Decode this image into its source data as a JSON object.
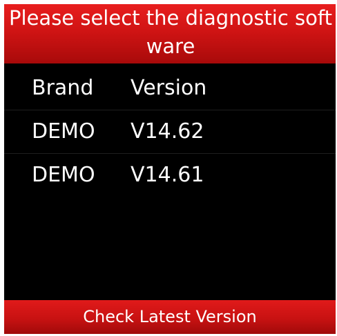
{
  "header": {
    "title": "Please select the diagnostic software"
  },
  "table": {
    "columns": [
      "Brand",
      "Version"
    ],
    "rows": [
      {
        "brand": "DEMO",
        "version": "V14.62"
      },
      {
        "brand": "DEMO",
        "version": "V14.61"
      }
    ]
  },
  "footer": {
    "button_label": "Check Latest Version"
  },
  "colors": {
    "accent": "#d01414",
    "background": "#000000",
    "text": "#ffffff"
  }
}
